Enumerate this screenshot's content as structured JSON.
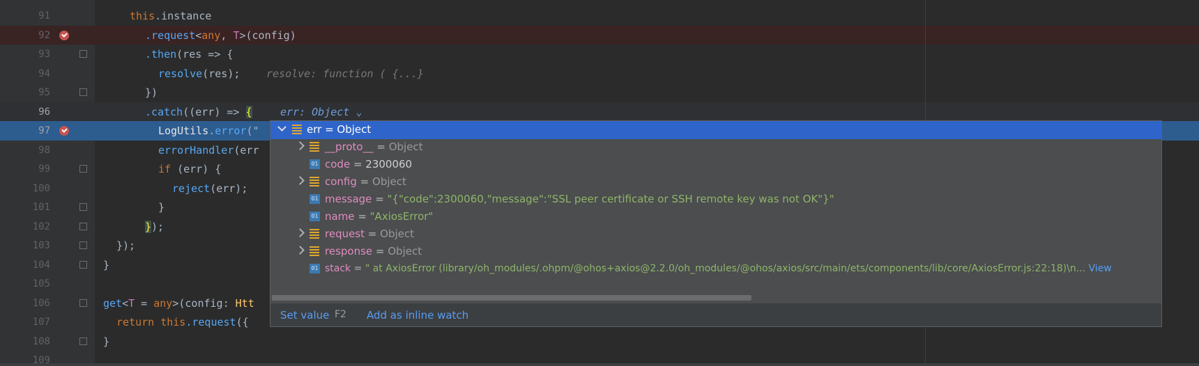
{
  "editor": {
    "lines": [
      {
        "num": "91"
      },
      {
        "num": "92"
      },
      {
        "num": "93"
      },
      {
        "num": "94"
      },
      {
        "num": "95"
      },
      {
        "num": "96"
      },
      {
        "num": "97"
      },
      {
        "num": "98"
      },
      {
        "num": "99"
      },
      {
        "num": "100"
      },
      {
        "num": "101"
      },
      {
        "num": "102"
      },
      {
        "num": "103"
      },
      {
        "num": "104"
      },
      {
        "num": "105"
      },
      {
        "num": "106"
      },
      {
        "num": "107"
      },
      {
        "num": "108"
      },
      {
        "num": "109"
      }
    ],
    "tokens": {
      "l91_this": "this",
      "l91_instance": ".instance",
      "l92_request": ".request",
      "l92_generic_open": "<",
      "l92_any": "any",
      "l92_comma": ", ",
      "l92_T": "T",
      "l92_rest": ">(config)",
      "l93_then": ".then",
      "l93_rest": "(res => {",
      "l94_resolve": "resolve",
      "l94_rest": "(res);",
      "l94_hint": "resolve: function ( {...}",
      "l95_close": "})",
      "l96_catch": ".catch",
      "l96_rest": "((err) => ",
      "l96_brace": "{",
      "l96_inline": "err: Object",
      "l97_logutils": "LogUtils",
      "l97_dot": ".",
      "l97_error": "error",
      "l97_rest": "(\"",
      "l98_handler": "errorHandler",
      "l98_rest": "(err",
      "l99_if": "if",
      "l99_rest": " (err) {",
      "l100_reject": "reject",
      "l100_rest": "(err);",
      "l101_brace": "}",
      "l102_brace": "}",
      "l102_rest": ");",
      "l103_close": "});",
      "l104_close": "}",
      "l106_get": "get",
      "l106_lt": "<",
      "l106_T": "T",
      "l106_eq": " = ",
      "l106_any": "any",
      "l106_rest": ">(config: ",
      "l106_type": "Htt",
      "l107_return": "return",
      "l107_this": " this",
      "l107_request": ".request",
      "l107_rest": "({ ",
      "l108_close": "}"
    }
  },
  "popup": {
    "header": {
      "name": "err",
      "eq": " = ",
      "type": "Object"
    },
    "items": [
      {
        "name": "__proto__",
        "eq": " = ",
        "value": "Object"
      },
      {
        "name": "code",
        "eq": " = ",
        "value": "2300060"
      },
      {
        "name": "config",
        "eq": " = ",
        "value": "Object"
      },
      {
        "name": "message",
        "eq": " = ",
        "value": "\"{\"code\":2300060,\"message\":\"SSL peer certificate or SSH remote key was not OK\"}\""
      },
      {
        "name": "name",
        "eq": " = ",
        "value": "\"AxiosError\""
      },
      {
        "name": "request",
        "eq": " = ",
        "value": "Object"
      },
      {
        "name": "response",
        "eq": " = ",
        "value": "Object"
      },
      {
        "name": "stack",
        "eq": " = ",
        "value": "\"    at AxiosError (library/oh_modules/.ohpm/@ohos+axios@2.2.0/oh_modules/@ohos/axios/src/main/ets/components/lib/core/AxiosError.js:22:18)\\n...",
        "link": "View"
      }
    ],
    "footer": {
      "set_value": "Set value",
      "set_value_key": "F2",
      "add_watch": "Add as inline watch"
    }
  }
}
